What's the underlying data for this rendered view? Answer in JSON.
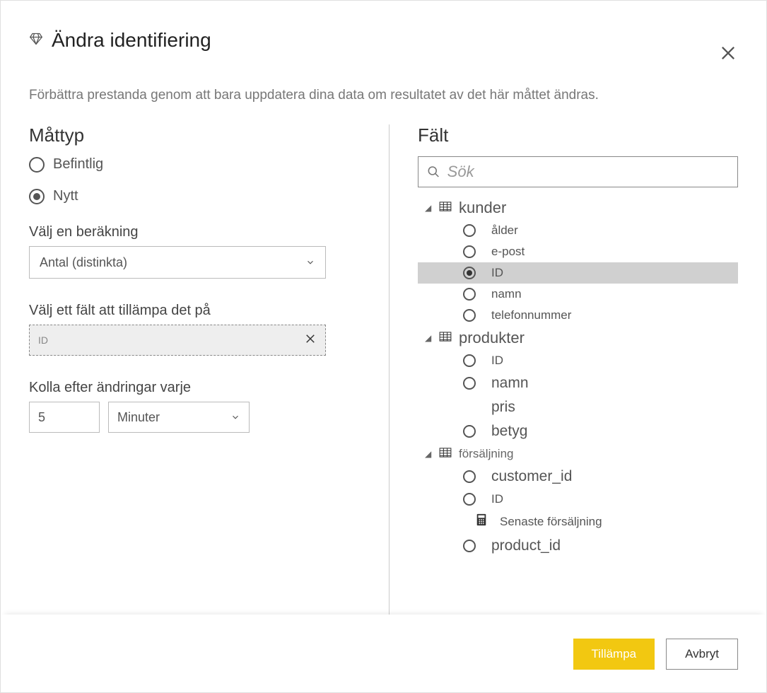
{
  "header": {
    "title": "Ändra identifiering"
  },
  "subtitle": "Förbättra prestanda genom att bara uppdatera dina data om resultatet av det här måttet ändras.",
  "left": {
    "mattyp_title": "Måttyp",
    "radio_befintlig": "Befintlig",
    "radio_nytt": "Nytt",
    "calc_label": "Välj en beräkning",
    "calc_value": "Antal (distinkta)",
    "field_label": "Välj ett fält att tillämpa det på",
    "field_value": "ID",
    "interval_label": "Kolla efter ändringar varje",
    "interval_value": "5",
    "interval_unit": "Minuter"
  },
  "right": {
    "title": "Fält",
    "search_placeholder": "Sök",
    "tables": {
      "kunder": {
        "name": "kunder",
        "fields": {
          "alder": "ålder",
          "epost": "e-post",
          "id": "ID",
          "namn": "namn",
          "telefon": "telefonnummer"
        }
      },
      "produkter": {
        "name": "produkter",
        "fields": {
          "id": "ID",
          "namn": "namn",
          "pris": "pris",
          "betyg": "betyg"
        }
      },
      "forsaljning": {
        "name": "försäljning",
        "fields": {
          "customer_id": "customer_id",
          "id": "ID",
          "senaste": "Senaste försäljning",
          "product_id": "product_id"
        }
      }
    }
  },
  "footer": {
    "apply": "Tillämpa",
    "cancel": "Avbryt"
  }
}
